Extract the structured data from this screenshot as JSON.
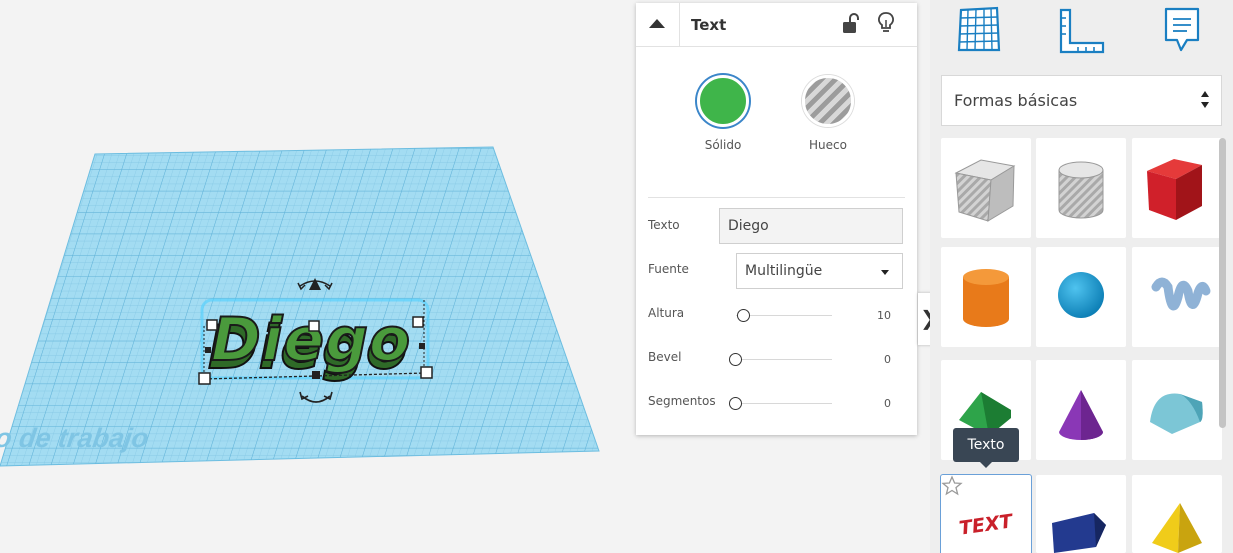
{
  "workplane": {
    "label": "Plano de trabajo",
    "object_text": "Diego",
    "grid_color": "#a3dcf2",
    "object_color": "#4a9a3c"
  },
  "inspector": {
    "title": "Text",
    "solid_label": "Sólido",
    "hole_label": "Hueco",
    "solid_color": "#3fb54a",
    "text_label": "Texto",
    "text_value": "Diego",
    "font_label": "Fuente",
    "font_value": "Multilingüe",
    "height_label": "Altura",
    "height_value": "10",
    "bevel_label": "Bevel",
    "bevel_value": "0",
    "segments_label": "Segmentos",
    "segments_value": "0"
  },
  "expand_handle": "❯",
  "shapes_panel": {
    "category": "Formas básicas",
    "tooltip": "Texto",
    "shapes": [
      {
        "name": "hole-box"
      },
      {
        "name": "hole-cylinder"
      },
      {
        "name": "box"
      },
      {
        "name": "cylinder"
      },
      {
        "name": "sphere"
      },
      {
        "name": "scribble"
      },
      {
        "name": "roof"
      },
      {
        "name": "cone"
      },
      {
        "name": "round-roof"
      },
      {
        "name": "text"
      },
      {
        "name": "polygon"
      },
      {
        "name": "pyramid"
      }
    ]
  }
}
